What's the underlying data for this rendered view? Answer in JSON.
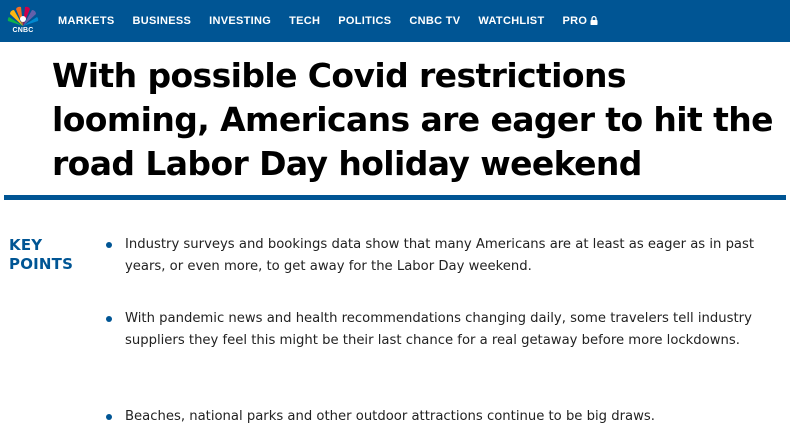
{
  "brand": {
    "logo_text": "CNBC",
    "accent": "#005594"
  },
  "nav": {
    "items": [
      {
        "label": "MARKETS"
      },
      {
        "label": "BUSINESS"
      },
      {
        "label": "INVESTING"
      },
      {
        "label": "TECH"
      },
      {
        "label": "POLITICS"
      },
      {
        "label": "CNBC TV"
      },
      {
        "label": "WATCHLIST"
      },
      {
        "label": "PRO",
        "icon": "lock-icon"
      }
    ]
  },
  "article": {
    "headline": "With possible Covid restrictions looming, Americans are eager to hit the road Labor Day holiday weekend",
    "key_points_label": "KEY POINTS",
    "key_points": [
      "Industry surveys and bookings data show that many Americans are at least as eager as in past years, or even more, to get away for the Labor Day weekend.",
      "With pandemic news and health recommendations changing daily, some travelers tell industry suppliers they feel this might be their last chance for a real getaway before more lockdowns.",
      "Beaches, national parks and other outdoor attractions continue to be big draws."
    ]
  }
}
